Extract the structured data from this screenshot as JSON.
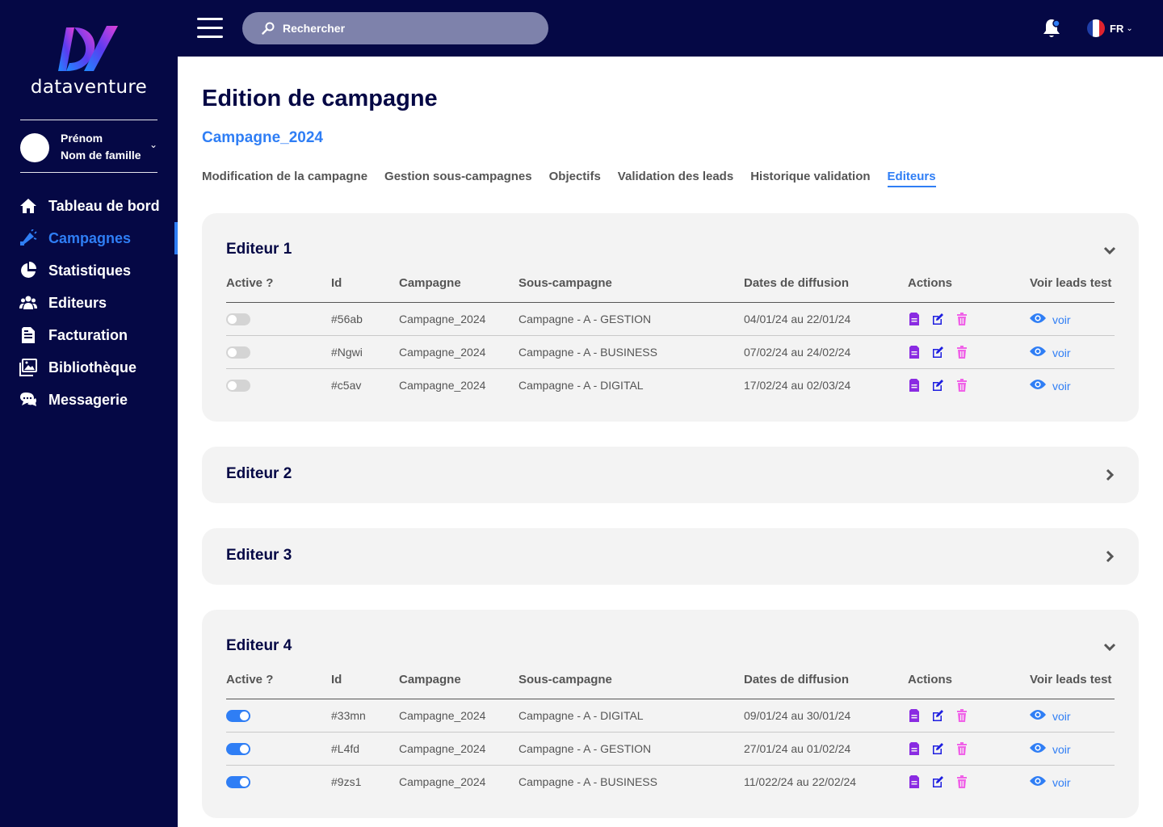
{
  "brand": {
    "name": "dataventure"
  },
  "user": {
    "first_name": "Prénom",
    "last_name": "Nom de famille"
  },
  "nav": [
    {
      "label": "Tableau de bord",
      "icon": "home-icon",
      "active": false
    },
    {
      "label": "Campagnes",
      "icon": "megaphone-icon",
      "active": true
    },
    {
      "label": "Statistiques",
      "icon": "pie-chart-icon",
      "active": false
    },
    {
      "label": "Editeurs",
      "icon": "users-icon",
      "active": false
    },
    {
      "label": "Facturation",
      "icon": "invoice-icon",
      "active": false
    },
    {
      "label": "Bibliothèque",
      "icon": "images-icon",
      "active": false
    },
    {
      "label": "Messagerie",
      "icon": "chat-icon",
      "active": false
    }
  ],
  "search": {
    "placeholder": "Rechercher"
  },
  "language": {
    "code": "FR"
  },
  "page": {
    "title": "Edition de campagne",
    "campaign": "Campagne_2024"
  },
  "tabs": [
    {
      "label": "Modification de la campagne",
      "active": false
    },
    {
      "label": "Gestion sous-campagnes",
      "active": false
    },
    {
      "label": "Objectifs",
      "active": false
    },
    {
      "label": "Validation des leads",
      "active": false
    },
    {
      "label": "Historique validation",
      "active": false
    },
    {
      "label": "Editeurs",
      "active": true
    }
  ],
  "columns": {
    "active": "Active ?",
    "id": "Id",
    "campaign": "Campagne",
    "subcampaign": "Sous-campagne",
    "dates": "Dates de diffusion",
    "actions": "Actions",
    "leads": "Voir leads test"
  },
  "voir_label": "voir",
  "colors": {
    "navy": "#050845",
    "accent": "#2f7ef5",
    "doc": "#8a2be2",
    "edit": "#1e1ee0",
    "delete": "#f062e8"
  },
  "editors": [
    {
      "title": "Editeur 1",
      "expanded": true,
      "rows": [
        {
          "active": false,
          "id": "#56ab",
          "campaign": "Campagne_2024",
          "subcampaign": "Campagne - A - GESTION",
          "dates": "04/01/24 au 22/01/24"
        },
        {
          "active": false,
          "id": "#Ngwi",
          "campaign": "Campagne_2024",
          "subcampaign": "Campagne - A - BUSINESS",
          "dates": "07/02/24 au 24/02/24"
        },
        {
          "active": false,
          "id": "#c5av",
          "campaign": "Campagne_2024",
          "subcampaign": "Campagne - A - DIGITAL",
          "dates": "17/02/24 au 02/03/24"
        }
      ]
    },
    {
      "title": "Editeur 2",
      "expanded": false,
      "rows": []
    },
    {
      "title": "Editeur 3",
      "expanded": false,
      "rows": []
    },
    {
      "title": "Editeur 4",
      "expanded": true,
      "rows": [
        {
          "active": true,
          "id": "#33mn",
          "campaign": "Campagne_2024",
          "subcampaign": "Campagne - A - DIGITAL",
          "dates": "09/01/24 au 30/01/24"
        },
        {
          "active": true,
          "id": "#L4fd",
          "campaign": "Campagne_2024",
          "subcampaign": "Campagne - A - GESTION",
          "dates": "27/01/24 au 01/02/24"
        },
        {
          "active": true,
          "id": "#9zs1",
          "campaign": "Campagne_2024",
          "subcampaign": "Campagne - A - BUSINESS",
          "dates": "11/022/24 au 22/02/24"
        }
      ]
    }
  ]
}
